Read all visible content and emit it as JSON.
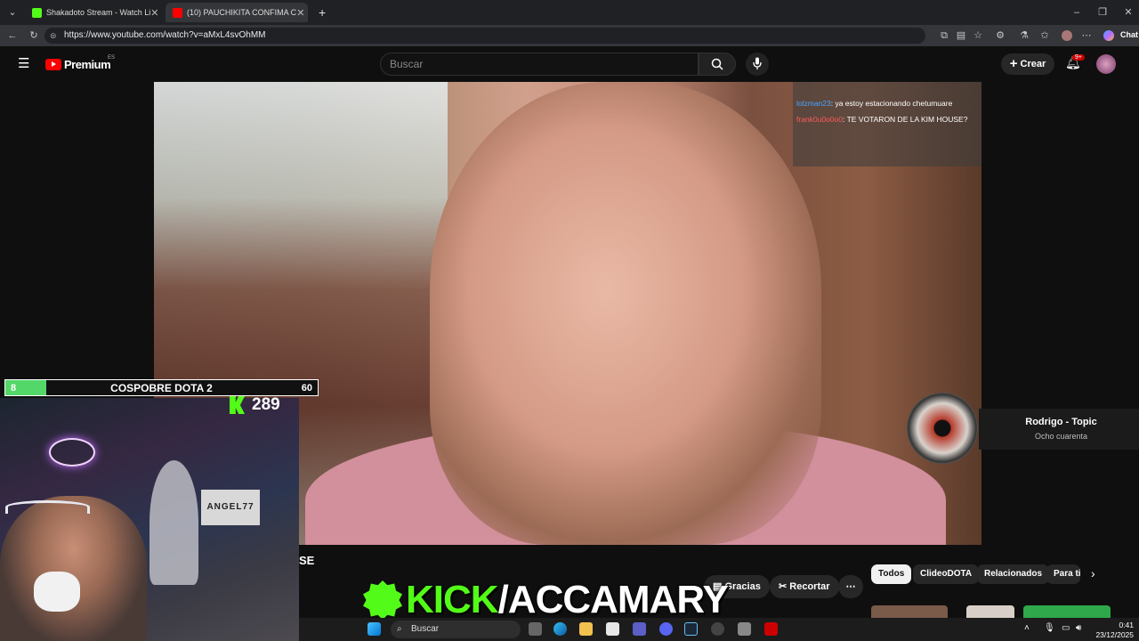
{
  "browser": {
    "tabs": [
      {
        "title": "Shakadoto Stream - Watch Li",
        "favicon_color": "#53fc18"
      },
      {
        "title": "(10) PAUCHIKITA CONFIMA C",
        "favicon_color": "#ff0000"
      }
    ],
    "new_tab_label": "+",
    "url": "https://www.youtube.com/watch?v=aMxL4svOhMM",
    "chat_label": "Chat"
  },
  "youtube": {
    "logo_text": "Premium",
    "logo_region": "ES",
    "search_placeholder": "Buscar",
    "create_label": "Crear",
    "notif_count": "9+"
  },
  "video": {
    "chat_overlay": [
      {
        "user": "lolzman23",
        "text": ": ya estoy estacionando chetumuare"
      },
      {
        "user": "frank0u0o0o0",
        "text": ": TE VOTARON DE LA KIM HOUSE?"
      }
    ],
    "title_fragment": "SE"
  },
  "stream_overlay": {
    "bar_left": "8",
    "bar_title": "COSPOBRE DOTA 2",
    "bar_right": "60",
    "bar_progress": 0.13,
    "viewer_count": "289",
    "cam_sign": "ANGEL77",
    "banner_prefix": "KICK",
    "banner_suffix": "/ACCAMARY"
  },
  "actions": {
    "thanks_label": "Gracias",
    "clip_label": "Recortar",
    "more_label": "⋯"
  },
  "filters": [
    "Todos",
    "ClideoDOTA",
    "Relacionados",
    "Para ti"
  ],
  "mini_player": {
    "artist": "Rodrigo - Topic",
    "track": "Ocho cuarenta"
  },
  "taskbar": {
    "search_label": "Buscar",
    "time": "0:41",
    "date": "23/12/2025"
  },
  "colors": {
    "kick_green": "#53fc18",
    "youtube_red": "#ff0000"
  }
}
